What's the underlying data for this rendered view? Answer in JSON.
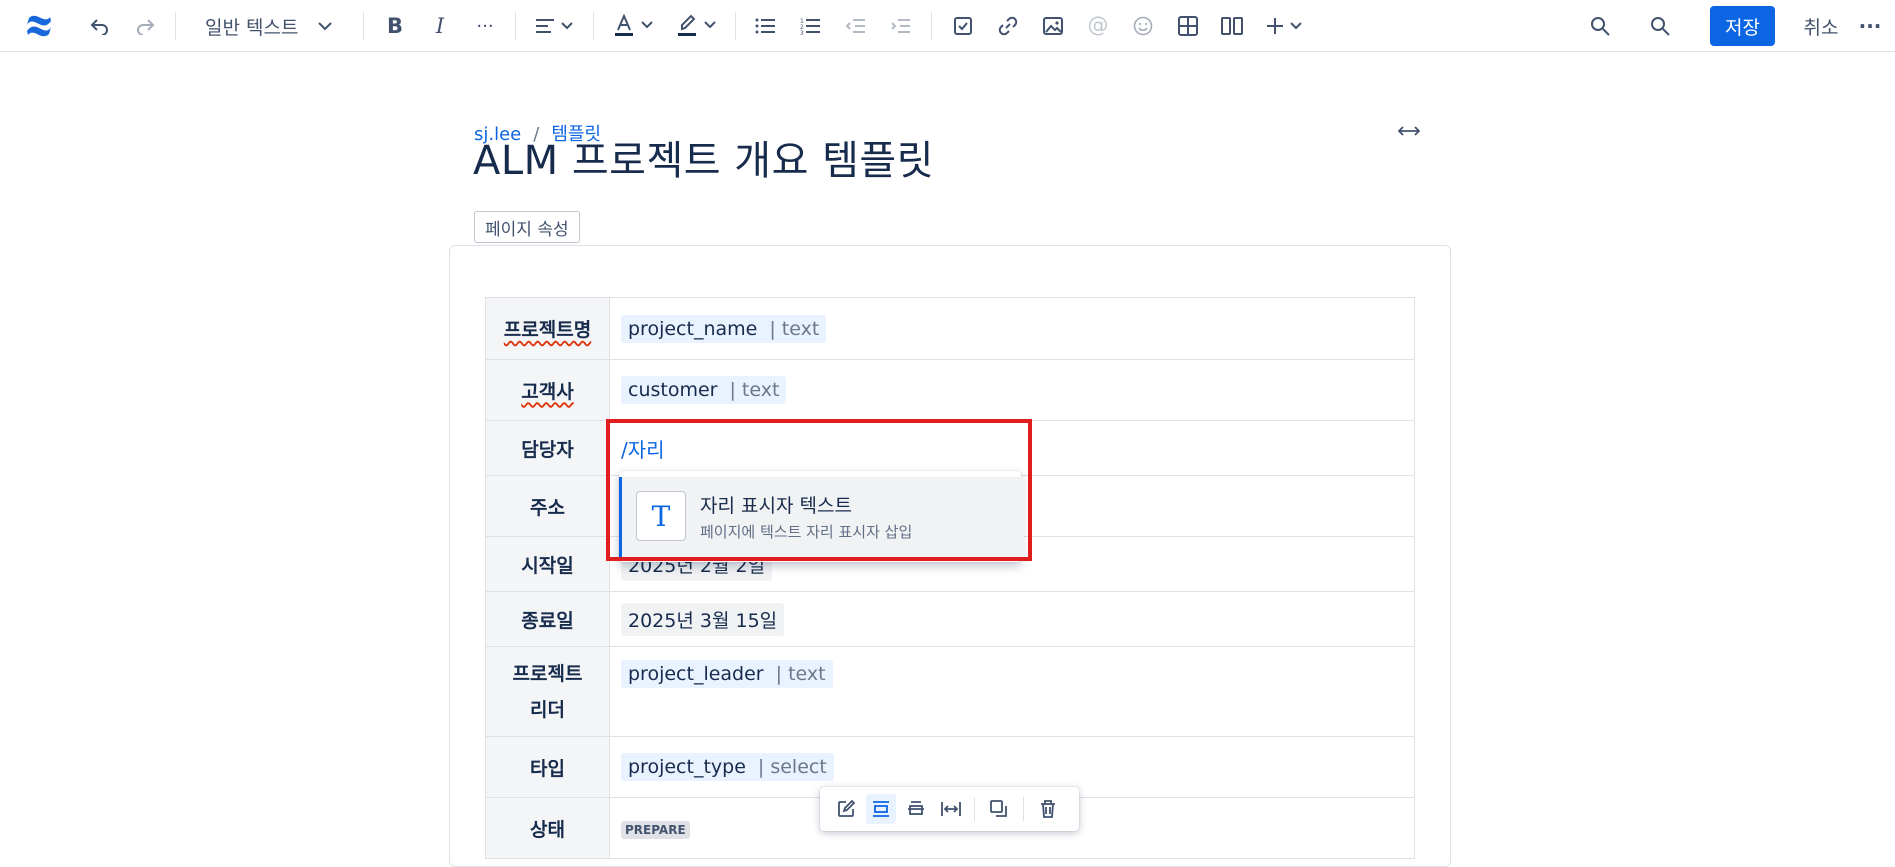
{
  "toolbar": {
    "text_style": "일반 텍스트",
    "save_label": "저장",
    "cancel_label": "취소"
  },
  "breadcrumb": {
    "user": "sj.lee",
    "section": "템플릿"
  },
  "page": {
    "title": "ALM 프로젝트 개요 템플릿",
    "properties_label": "페이지 속성"
  },
  "table": {
    "rows": [
      {
        "label": "프로젝트명",
        "value": "project_name",
        "type": "| text"
      },
      {
        "label": "고객사",
        "value": "customer",
        "type": "| text"
      },
      {
        "label": "담당자",
        "typed": "/자리"
      },
      {
        "label": "주소"
      },
      {
        "label": "시작일",
        "value": "2025년 2월 2일"
      },
      {
        "label": "종료일",
        "value": "2025년 3월 15일"
      },
      {
        "label": "프로젝트 리더",
        "label_line1": "프로젝트",
        "label_line2": "리더",
        "value": "project_leader",
        "type": "| text"
      },
      {
        "label": "타입",
        "value": "project_type",
        "type": "| select"
      },
      {
        "label": "상태",
        "value": "PREPARE"
      }
    ]
  },
  "dropdown": {
    "icon_letter": "T",
    "title": "자리 표시자 텍스트",
    "description": "페이지에 텍스트 자리 표시자 삽입"
  },
  "colors": {
    "accent": "#0c66e4",
    "highlight": "#e01e1e"
  }
}
